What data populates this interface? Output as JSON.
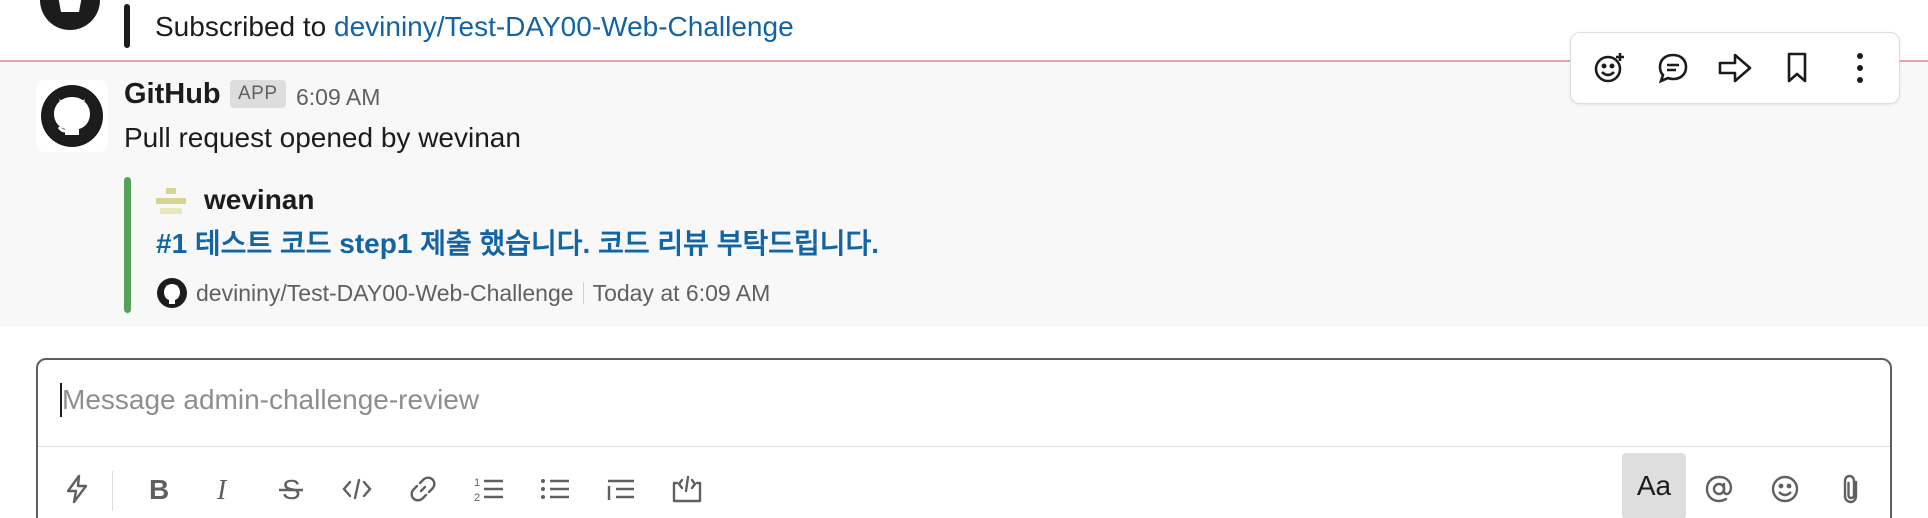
{
  "previous_message": {
    "prefix": "Subscribed to",
    "repo_link": "devininy/Test-DAY00-Web-Challenge"
  },
  "message": {
    "sender": "GitHub",
    "badge": "APP",
    "time": "6:09 AM",
    "body": "Pull request opened by wevinan",
    "attachment": {
      "author": "wevinan",
      "title": "#1 테스트 코드 step1 제출 했습니다. 코드 리뷰 부탁드립니다.",
      "footer_repo": "devininy/Test-DAY00-Web-Challenge",
      "footer_time": "Today at 6:09 AM",
      "accent_color": "#55a35a"
    }
  },
  "hover_actions": [
    "add-reaction-icon",
    "reply-in-thread-icon",
    "share-message-icon",
    "save-bookmark-icon",
    "more-actions-icon"
  ],
  "composer": {
    "placeholder": "Message admin-challenge-review",
    "toolbar": [
      "shortcuts-icon",
      "bold-icon",
      "italic-icon",
      "strikethrough-icon",
      "code-icon",
      "link-icon",
      "ordered-list-icon",
      "bulleted-list-icon",
      "indent-icon",
      "code-block-icon"
    ],
    "format_toggle": "Aa",
    "right_tools": [
      "mention-icon",
      "emoji-icon",
      "attach-icon"
    ]
  },
  "colors": {
    "link": "#1264a3",
    "new_divider": "#e8a3a8",
    "hover_bg": "#f8f8f8"
  }
}
